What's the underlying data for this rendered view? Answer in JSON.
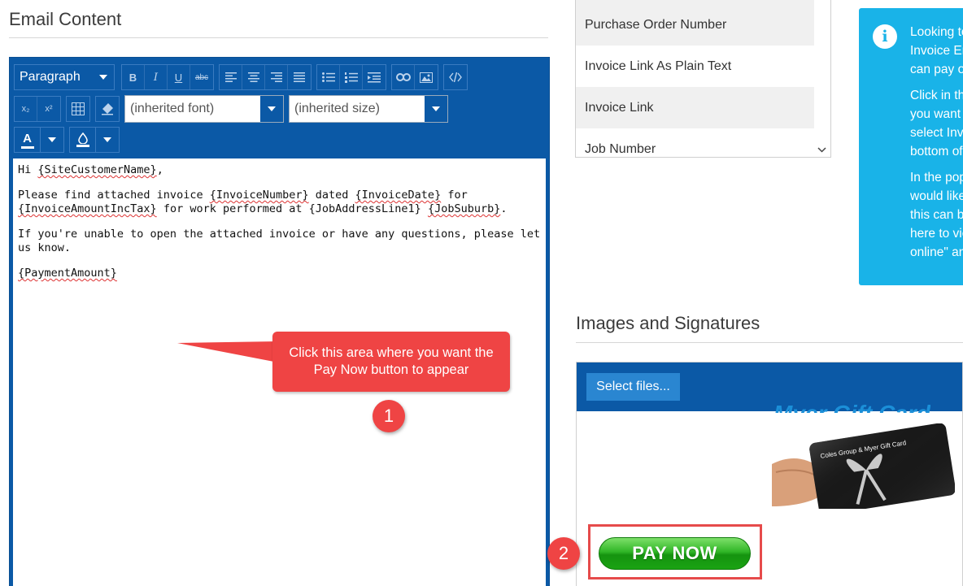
{
  "email_content": {
    "title": "Email Content",
    "toolbar": {
      "format_select": "Paragraph",
      "font_select": "(inherited font)",
      "size_select": "(inherited size)",
      "buttons": {
        "bold": "B",
        "italic": "I",
        "underline": "U",
        "strikethrough": "abc",
        "subscript": "x₂",
        "superscript": "x²",
        "text_color": "A"
      }
    },
    "body": {
      "greeting_prefix": "Hi ",
      "site_customer_name": "{SiteCustomerName}",
      "greeting_suffix": ",",
      "line2_a": "Please find attached invoice ",
      "invoice_number": "{InvoiceNumber}",
      "line2_b": " dated ",
      "invoice_date": "{InvoiceDate}",
      "line2_c": " for",
      "invoice_amount": "{InvoiceAmountIncTax}",
      "line2_d": " for work performed at {JobAddressLine1} ",
      "job_suburb": "{JobSuburb}",
      "line2_e": ".",
      "line3": "If you're unable to open the attached invoice or have any questions, please let us know.",
      "payment_amount": "{PaymentAmount}"
    }
  },
  "callout": {
    "text": "Click this area where you want the Pay Now button to appear",
    "badge_1": "1",
    "badge_2": "2"
  },
  "placeholders": {
    "items": [
      "Purchase Order Number",
      "Invoice Link As Plain Text",
      "Invoice Link",
      "Job Number"
    ]
  },
  "info_box": {
    "icon": "i",
    "para1": [
      "Looking to",
      "Invoice Em",
      "can pay o"
    ],
    "para2": [
      "Click in th",
      "you want",
      "select Inv",
      "bottom of"
    ],
    "para3": [
      "In the pop",
      "would like",
      "this can b",
      "here to vie",
      "online\" an"
    ]
  },
  "images_signatures": {
    "title": "Images and Signatures",
    "select_files": "Select files...",
    "gift_card_title": "Myer Gift Card",
    "gift_card_label": "Coles Group & Myer Gift Card",
    "pay_now": "PAY NOW"
  },
  "colors": {
    "editor_blue": "#0b59a6",
    "callout_red": "#ef4444",
    "info_cyan": "#19b3e8",
    "pay_green": "#2fb526"
  }
}
